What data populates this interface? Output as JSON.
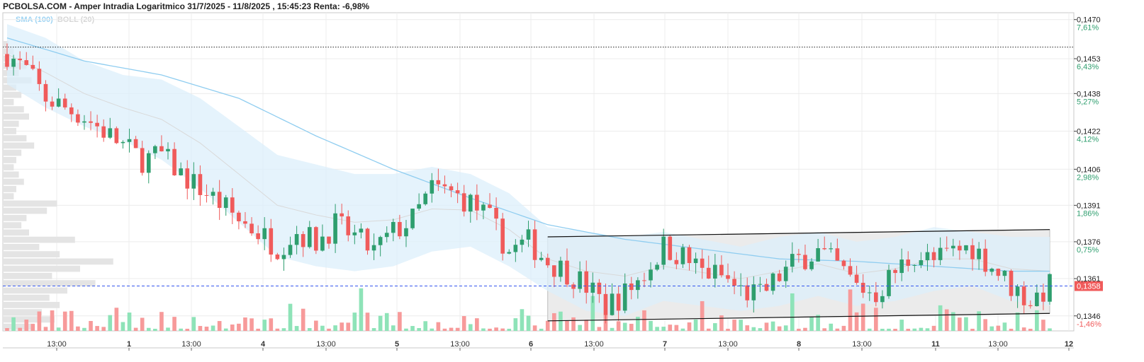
{
  "header": {
    "title": "PCBOLSA.COM - Amper Intradia Logaritmico 31/7/2025 - 11/8/2025 , 15:45:23 Renta: -6,98%",
    "legend_sma": "SMA (100)",
    "legend_boll": "BOLL (20)"
  },
  "colors": {
    "up": "#2e9e6e",
    "down": "#f05b5b",
    "volume_up": "#8ee3b8",
    "volume_down": "#f79a9a",
    "sma": "#8fcdf0",
    "bollinger_band": "#dceffb",
    "last_price": "#f05b5b",
    "last_price_line": "#3355ee",
    "pct_positive": "#2e9e6e",
    "pct_negative": "#f05b5b"
  },
  "chart_data": {
    "type": "candlestick",
    "scale": "log",
    "ylim": [
      0.134,
      0.1473
    ],
    "y_ticks": [
      {
        "price": "0,1470",
        "pct": "7,61%"
      },
      {
        "price": "0,1453",
        "pct": "6,43%"
      },
      {
        "price": "0,1438",
        "pct": "5,27%"
      },
      {
        "price": "0,1422",
        "pct": "4,12%"
      },
      {
        "price": "0,1406",
        "pct": "2,98%"
      },
      {
        "price": "0,1391",
        "pct": "1,86%"
      },
      {
        "price": "0,1376",
        "pct": "0,75%"
      },
      {
        "price": "0,1361",
        "pct": ""
      },
      {
        "price": "0,1346",
        "pct": "-1,46%"
      }
    ],
    "x_ticks": [
      {
        "label": "13:00",
        "day": false
      },
      {
        "label": "1",
        "day": true
      },
      {
        "label": "13:00",
        "day": false
      },
      {
        "label": "4",
        "day": true
      },
      {
        "label": "13:00",
        "day": false
      },
      {
        "label": "5",
        "day": true
      },
      {
        "label": "13:00",
        "day": false
      },
      {
        "label": "6",
        "day": true
      },
      {
        "label": "13:00",
        "day": false
      },
      {
        "label": "7",
        "day": true
      },
      {
        "label": "13:00",
        "day": false
      },
      {
        "label": "8",
        "day": true
      },
      {
        "label": "13:00",
        "day": false
      },
      {
        "label": "11",
        "day": true
      },
      {
        "label": "13:00",
        "day": false
      },
      {
        "label": "12",
        "day": true
      }
    ],
    "last_price": "0,1358",
    "reference_line": 0.1458,
    "close_path": [
      [
        0,
        0.1455
      ],
      [
        3,
        0.1448
      ],
      [
        6,
        0.1436
      ],
      [
        9,
        0.1432
      ],
      [
        12,
        0.1428
      ],
      [
        15,
        0.1422
      ],
      [
        18,
        0.1416
      ],
      [
        21,
        0.141
      ],
      [
        24,
        0.1412
      ],
      [
        27,
        0.1404
      ],
      [
        30,
        0.1398
      ],
      [
        33,
        0.1392
      ],
      [
        36,
        0.1385
      ],
      [
        39,
        0.138
      ],
      [
        42,
        0.1374
      ],
      [
        45,
        0.138
      ],
      [
        48,
        0.1376
      ],
      [
        51,
        0.1383
      ],
      [
        54,
        0.1378
      ],
      [
        57,
        0.1372
      ],
      [
        60,
        0.138
      ],
      [
        63,
        0.1385
      ],
      [
        66,
        0.1398
      ],
      [
        69,
        0.1396
      ],
      [
        72,
        0.1392
      ],
      [
        75,
        0.1385
      ],
      [
        78,
        0.1372
      ],
      [
        81,
        0.1376
      ],
      [
        84,
        0.1368
      ],
      [
        87,
        0.1364
      ],
      [
        90,
        0.1358
      ],
      [
        93,
        0.135
      ],
      [
        96,
        0.1355
      ],
      [
        99,
        0.1363
      ],
      [
        102,
        0.1374
      ],
      [
        105,
        0.137
      ],
      [
        108,
        0.1364
      ],
      [
        111,
        0.1362
      ],
      [
        114,
        0.1356
      ],
      [
        117,
        0.1354
      ],
      [
        120,
        0.1362
      ],
      [
        123,
        0.1369
      ],
      [
        126,
        0.1372
      ],
      [
        129,
        0.1366
      ],
      [
        132,
        0.1358
      ],
      [
        135,
        0.1355
      ],
      [
        138,
        0.1364
      ],
      [
        141,
        0.1371
      ],
      [
        144,
        0.1368
      ],
      [
        147,
        0.1372
      ],
      [
        150,
        0.1374
      ],
      [
        153,
        0.1366
      ],
      [
        156,
        0.1358
      ],
      [
        159,
        0.1352
      ],
      [
        162,
        0.1358
      ]
    ],
    "sma_path": [
      [
        0,
        0.1462
      ],
      [
        12,
        0.1452
      ],
      [
        24,
        0.1446
      ],
      [
        36,
        0.1436
      ],
      [
        48,
        0.142
      ],
      [
        60,
        0.1406
      ],
      [
        72,
        0.1394
      ],
      [
        84,
        0.1383
      ],
      [
        96,
        0.1377
      ],
      [
        108,
        0.1373
      ],
      [
        120,
        0.1369
      ],
      [
        132,
        0.1368
      ],
      [
        144,
        0.1366
      ],
      [
        156,
        0.1364
      ],
      [
        162,
        0.1364
      ]
    ],
    "bollinger_upper": [
      [
        0,
        0.1468
      ],
      [
        6,
        0.1462
      ],
      [
        12,
        0.1452
      ],
      [
        18,
        0.1446
      ],
      [
        24,
        0.1444
      ],
      [
        30,
        0.1436
      ],
      [
        36,
        0.1424
      ],
      [
        42,
        0.1412
      ],
      [
        48,
        0.1408
      ],
      [
        54,
        0.1404
      ],
      [
        60,
        0.1404
      ],
      [
        66,
        0.1407
      ],
      [
        72,
        0.1404
      ],
      [
        78,
        0.1396
      ],
      [
        84,
        0.1382
      ],
      [
        90,
        0.138
      ],
      [
        96,
        0.1378
      ],
      [
        102,
        0.138
      ],
      [
        108,
        0.1377
      ],
      [
        114,
        0.1374
      ],
      [
        120,
        0.1378
      ],
      [
        126,
        0.138
      ],
      [
        132,
        0.1376
      ],
      [
        138,
        0.1378
      ],
      [
        144,
        0.1382
      ],
      [
        150,
        0.138
      ],
      [
        156,
        0.1378
      ],
      [
        162,
        0.1378
      ]
    ],
    "bollinger_lower": [
      [
        0,
        0.1442
      ],
      [
        6,
        0.1432
      ],
      [
        12,
        0.1424
      ],
      [
        18,
        0.1418
      ],
      [
        24,
        0.141
      ],
      [
        30,
        0.1398
      ],
      [
        36,
        0.1384
      ],
      [
        42,
        0.137
      ],
      [
        48,
        0.1366
      ],
      [
        54,
        0.1364
      ],
      [
        60,
        0.1366
      ],
      [
        66,
        0.1372
      ],
      [
        72,
        0.1374
      ],
      [
        78,
        0.1366
      ],
      [
        84,
        0.1356
      ],
      [
        90,
        0.1348
      ],
      [
        96,
        0.1346
      ],
      [
        102,
        0.1352
      ],
      [
        108,
        0.135
      ],
      [
        114,
        0.1348
      ],
      [
        120,
        0.135
      ],
      [
        126,
        0.1354
      ],
      [
        132,
        0.135
      ],
      [
        138,
        0.1352
      ],
      [
        144,
        0.1356
      ],
      [
        150,
        0.1358
      ],
      [
        156,
        0.1352
      ],
      [
        162,
        0.135
      ]
    ],
    "channel_upper": [
      [
        84,
        0.1378
      ],
      [
        162,
        0.1381
      ]
    ],
    "channel_lower": [
      [
        84,
        0.1344
      ],
      [
        162,
        0.1347
      ]
    ],
    "volume_profile": [
      0.02,
      0.04,
      0.03,
      0.09,
      0.06,
      0.11,
      0.05,
      0.07,
      0.04,
      0.08,
      0.1,
      0.06,
      0.05,
      0.09,
      0.12,
      0.07,
      0.05,
      0.04,
      0.06,
      0.08,
      0.05,
      0.04,
      0.21,
      0.17,
      0.09,
      0.07,
      0.1,
      0.28,
      0.14,
      0.22,
      0.43,
      0.3,
      0.19,
      0.36,
      0.25,
      0.18,
      0.22,
      0.15,
      0.2,
      0.12
    ]
  }
}
